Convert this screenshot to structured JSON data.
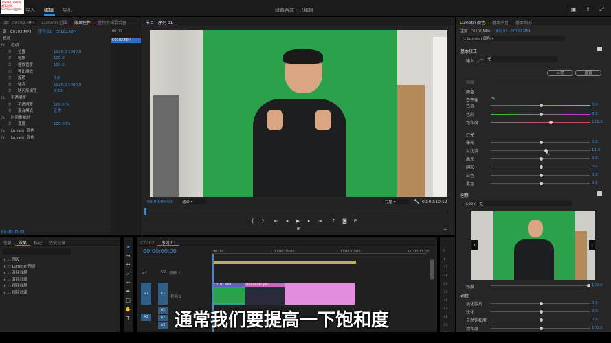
{
  "app": {
    "title": "绿幕合成 - 已编辑",
    "logo_text": "1080P(1080P) 新素材网 Sucaiwang.net"
  },
  "nav": {
    "home": "⌂",
    "import": "导入",
    "edit": "编辑",
    "export": "导出"
  },
  "source_panel": {
    "tabs": [
      "源：C0102.MP4",
      "Lumetri 范围",
      "效果控件",
      "音频剪辑混合器"
    ],
    "clip_label": "源 · C0102.MP4",
    "seq_label": "序列 01 · C0102.MP4",
    "time_marker": "00:00",
    "clip_chip": "C0102.MP4",
    "video_section": "视频",
    "rows": [
      {
        "t": "fx",
        "l": "运动",
        "v": ""
      },
      {
        "t": "p",
        "l": "位置",
        "v": "1920.0   1080.0"
      },
      {
        "t": "p",
        "l": "缩放",
        "v": "100.0"
      },
      {
        "t": "p",
        "l": "缩放宽度",
        "v": "100.0"
      },
      {
        "t": "c",
        "l": "等比缩放",
        "v": ""
      },
      {
        "t": "p",
        "l": "旋转",
        "v": "0.0"
      },
      {
        "t": "p",
        "l": "锚点",
        "v": "1920.0   1080.0"
      },
      {
        "t": "p",
        "l": "防闪烁滤镜",
        "v": "0.00"
      },
      {
        "t": "fx",
        "l": "不透明度",
        "v": ""
      },
      {
        "t": "p",
        "l": "不透明度",
        "v": "100.0 %"
      },
      {
        "t": "p",
        "l": "混合模式",
        "v": "正常"
      },
      {
        "t": "fx",
        "l": "时间重映射",
        "v": ""
      },
      {
        "t": "p",
        "l": "速度",
        "v": "100.00%"
      },
      {
        "t": "fx",
        "l": "Lumetri 颜色",
        "v": ""
      },
      {
        "t": "fx",
        "l": "Lumetri 颜色",
        "v": ""
      }
    ],
    "timecode": "00:00:00:00"
  },
  "program": {
    "tabs": [
      "节目：序列 01"
    ],
    "timecode": "00:00:00:00",
    "fit": "适合",
    "quality": "完整",
    "duration": "00:00:10:12"
  },
  "lumetri": {
    "tabs": [
      "Lumetri 颜色",
      "基本声音",
      "基本图形"
    ],
    "source_label": "主要 · C0102.MP4",
    "seq_label": "序列 01 · C0102.MP4",
    "fx_label": "Lumetri 颜色",
    "basic": "基本校正",
    "input_lut": "输入 LUT",
    "lut_value": "无",
    "auto": "自动",
    "reset": "重置",
    "intensity": "强度",
    "color": "颜色",
    "white_balance": "白平衡",
    "sliders": [
      {
        "l": "色温",
        "v": "0.0",
        "pos": 0.5,
        "grad": "linear-gradient(90deg,#3060e0,#e0a030)"
      },
      {
        "l": "色彩",
        "v": "0.0",
        "pos": 0.5,
        "grad": "linear-gradient(90deg,#30c030,#d030d0)"
      },
      {
        "l": "饱和度",
        "v": "121.2",
        "pos": 0.6,
        "grad": "linear-gradient(90deg,#777,#e04040)"
      }
    ],
    "light": "灯光",
    "light_sliders": [
      {
        "l": "曝光",
        "v": "0.0"
      },
      {
        "l": "对比度",
        "v": "11.3"
      },
      {
        "l": "高光",
        "v": "0.0"
      },
      {
        "l": "阴影",
        "v": "0.0"
      },
      {
        "l": "白色",
        "v": "0.0"
      },
      {
        "l": "黑色",
        "v": "0.0"
      }
    ],
    "creative": "创意",
    "look": "Look",
    "look_value": "无",
    "strength_label": "强度",
    "strength_value": "100.0",
    "adjust": "调整",
    "adjust_sliders": [
      {
        "l": "淡化胶片",
        "v": "0.0"
      },
      {
        "l": "锐化",
        "v": "0.0"
      },
      {
        "l": "自然饱和度",
        "v": "0.0"
      },
      {
        "l": "饱和度",
        "v": "100.0"
      }
    ]
  },
  "project": {
    "tabs": [
      "信息",
      "效果",
      "标记",
      "历史记录"
    ],
    "items": [
      "预设",
      "Lumetri 预设",
      "音频效果",
      "音频过渡",
      "视频效果",
      "视频过渡"
    ]
  },
  "timeline": {
    "tabs": [
      "C0102",
      "序列 01"
    ],
    "timecode": "00:00:00:00",
    "ruler": [
      "00:00",
      "00:00:05:00",
      "00:00:10:00",
      "00:00:15:00"
    ],
    "video_tracks": [
      "V3",
      "V2",
      "V1"
    ],
    "audio_tracks": [
      "A1",
      "A2",
      "A3"
    ],
    "v2_label": "视频 2",
    "v1_label": "视频 1",
    "clip1": "C0102.MP4",
    "clip2": "DSC09545.JPG"
  },
  "meter": [
    "0",
    "-6",
    "-12",
    "-18",
    "-24",
    "-30",
    "-36",
    "-42",
    "-48",
    "-54",
    "dB"
  ],
  "subtitle": "通常我们要提高一下饱和度"
}
